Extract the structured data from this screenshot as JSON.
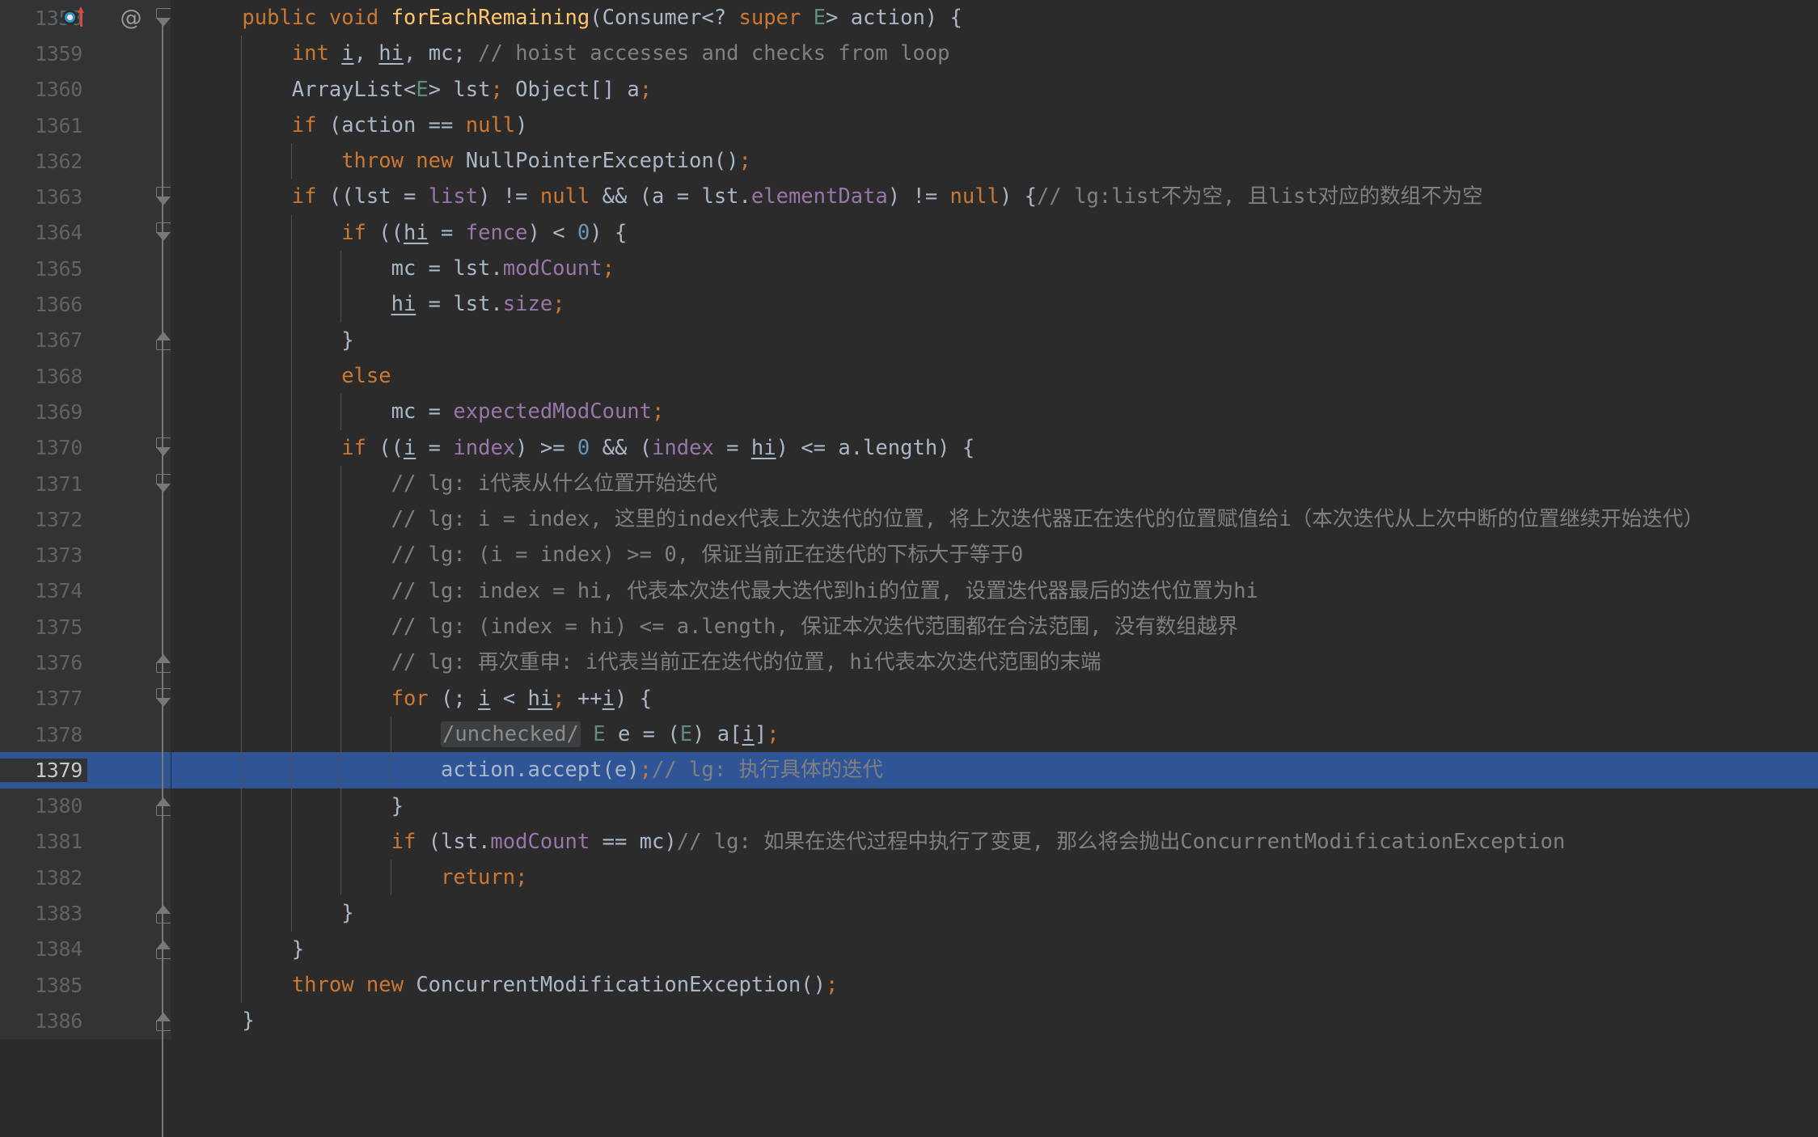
{
  "editor": {
    "theme_name": "darcula",
    "background": "#2b2b2b",
    "gutter_background": "#313335",
    "selection_color": "#2f5597",
    "caret_line": 1379,
    "colors": {
      "keyword": "#cc7832",
      "method": "#ffc66d",
      "field": "#9876aa",
      "number": "#6897bb",
      "comment": "#808080",
      "text": "#a9b7c6",
      "type_param": "#5f8c7c",
      "inlay_hint_bg": "#3c3f41",
      "line_number": "#606366"
    },
    "gutter_icons": {
      "override_icon_label": "implements-method-icon",
      "annotation_icon_label": "@",
      "fold_icon_label": "fold-region-icon",
      "bulb_icon_label": "intention-bulb-icon"
    },
    "lines": [
      {
        "number": "1358",
        "indent": 1,
        "icons": [
          "override-icon",
          "at-icon",
          "fold-collapse-icon"
        ],
        "tokens": [
          {
            "t": "kw",
            "s": "public void "
          },
          {
            "t": "meth",
            "s": "forEachRemaining"
          },
          {
            "t": "pun",
            "s": "(Consumer<? "
          },
          {
            "t": "kw",
            "s": "super "
          },
          {
            "t": "gen",
            "s": "E"
          },
          {
            "t": "pun",
            "s": "> action) {"
          }
        ]
      },
      {
        "number": "1359",
        "indent": 2,
        "icons": [],
        "tokens": [
          {
            "t": "kw",
            "s": "int "
          },
          {
            "t": "und",
            "s": "i"
          },
          {
            "t": "pun",
            "s": ", "
          },
          {
            "t": "und",
            "s": "hi"
          },
          {
            "t": "pun",
            "s": ", mc; "
          },
          {
            "t": "cmt",
            "s": "// hoist accesses and checks from loop"
          }
        ]
      },
      {
        "number": "1360",
        "indent": 2,
        "icons": [],
        "tokens": [
          {
            "t": "pun",
            "s": "ArrayList<"
          },
          {
            "t": "gen",
            "s": "E"
          },
          {
            "t": "pun",
            "s": "> lst"
          },
          {
            "t": "semi",
            "s": ";"
          },
          {
            "t": "pun",
            "s": " Object[] a"
          },
          {
            "t": "semi",
            "s": ";"
          }
        ]
      },
      {
        "number": "1361",
        "indent": 2,
        "icons": [],
        "tokens": [
          {
            "t": "kw",
            "s": "if "
          },
          {
            "t": "pun",
            "s": "(action == "
          },
          {
            "t": "kw",
            "s": "null"
          },
          {
            "t": "pun",
            "s": ")"
          }
        ]
      },
      {
        "number": "1362",
        "indent": 3,
        "icons": [],
        "tokens": [
          {
            "t": "kw",
            "s": "throw new "
          },
          {
            "t": "pun",
            "s": "NullPointerException()"
          },
          {
            "t": "semi",
            "s": ";"
          }
        ]
      },
      {
        "number": "1363",
        "indent": 2,
        "icons": [
          "fold-collapse-icon"
        ],
        "tokens": [
          {
            "t": "kw",
            "s": "if "
          },
          {
            "t": "pun",
            "s": "((lst = "
          },
          {
            "t": "fld",
            "s": "list"
          },
          {
            "t": "pun",
            "s": ") != "
          },
          {
            "t": "kw",
            "s": "null"
          },
          {
            "t": "pun",
            "s": " && (a = lst."
          },
          {
            "t": "fld",
            "s": "elementData"
          },
          {
            "t": "pun",
            "s": ") != "
          },
          {
            "t": "kw",
            "s": "null"
          },
          {
            "t": "pun",
            "s": ") {"
          },
          {
            "t": "cmt",
            "s": "// lg:list不为空, 且list对应的数组不为空"
          }
        ]
      },
      {
        "number": "1364",
        "indent": 3,
        "icons": [
          "fold-collapse-icon"
        ],
        "tokens": [
          {
            "t": "kw",
            "s": "if "
          },
          {
            "t": "pun",
            "s": "(("
          },
          {
            "t": "und",
            "s": "hi"
          },
          {
            "t": "pun",
            "s": " = "
          },
          {
            "t": "fld",
            "s": "fence"
          },
          {
            "t": "pun",
            "s": ") < "
          },
          {
            "t": "num",
            "s": "0"
          },
          {
            "t": "pun",
            "s": ") {"
          }
        ]
      },
      {
        "number": "1365",
        "indent": 4,
        "icons": [],
        "tokens": [
          {
            "t": "pun",
            "s": "mc = lst."
          },
          {
            "t": "fld",
            "s": "modCount"
          },
          {
            "t": "semi",
            "s": ";"
          }
        ]
      },
      {
        "number": "1366",
        "indent": 4,
        "icons": [],
        "tokens": [
          {
            "t": "und",
            "s": "hi"
          },
          {
            "t": "pun",
            "s": " = lst."
          },
          {
            "t": "fld",
            "s": "size"
          },
          {
            "t": "semi",
            "s": ";"
          }
        ]
      },
      {
        "number": "1367",
        "indent": 3,
        "icons": [
          "fold-expand-icon"
        ],
        "tokens": [
          {
            "t": "pun",
            "s": "}"
          }
        ]
      },
      {
        "number": "1368",
        "indent": 3,
        "icons": [],
        "tokens": [
          {
            "t": "kw",
            "s": "else"
          }
        ]
      },
      {
        "number": "1369",
        "indent": 4,
        "icons": [],
        "tokens": [
          {
            "t": "pun",
            "s": "mc = "
          },
          {
            "t": "fld",
            "s": "expectedModCount"
          },
          {
            "t": "semi",
            "s": ";"
          }
        ]
      },
      {
        "number": "1370",
        "indent": 3,
        "icons": [
          "fold-collapse-icon"
        ],
        "tokens": [
          {
            "t": "kw",
            "s": "if "
          },
          {
            "t": "pun",
            "s": "(("
          },
          {
            "t": "und",
            "s": "i"
          },
          {
            "t": "pun",
            "s": " = "
          },
          {
            "t": "fld",
            "s": "index"
          },
          {
            "t": "pun",
            "s": ") >= "
          },
          {
            "t": "num",
            "s": "0"
          },
          {
            "t": "pun",
            "s": " && ("
          },
          {
            "t": "fld",
            "s": "index"
          },
          {
            "t": "pun",
            "s": " = "
          },
          {
            "t": "und",
            "s": "hi"
          },
          {
            "t": "pun",
            "s": ") <= a.length) {"
          }
        ]
      },
      {
        "number": "1371",
        "indent": 4,
        "icons": [
          "fold-collapse-icon"
        ],
        "tokens": [
          {
            "t": "cmt",
            "s": "// lg: i代表从什么位置开始迭代"
          }
        ]
      },
      {
        "number": "1372",
        "indent": 4,
        "icons": [],
        "tokens": [
          {
            "t": "cmt",
            "s": "// lg: i = index, 这里的index代表上次迭代的位置, 将上次迭代器正在迭代的位置赋值给i（本次迭代从上次中断的位置继续开始迭代）"
          }
        ]
      },
      {
        "number": "1373",
        "indent": 4,
        "icons": [],
        "tokens": [
          {
            "t": "cmt",
            "s": "// lg: (i = index) >= 0, 保证当前正在迭代的下标大于等于0"
          }
        ]
      },
      {
        "number": "1374",
        "indent": 4,
        "icons": [],
        "tokens": [
          {
            "t": "cmt",
            "s": "// lg: index = hi, 代表本次迭代最大迭代到hi的位置, 设置迭代器最后的迭代位置为hi"
          }
        ]
      },
      {
        "number": "1375",
        "indent": 4,
        "icons": [],
        "tokens": [
          {
            "t": "cmt",
            "s": "// lg: (index = hi) <= a.length, 保证本次迭代范围都在合法范围, 没有数组越界"
          }
        ]
      },
      {
        "number": "1376",
        "indent": 4,
        "icons": [
          "fold-expand-icon"
        ],
        "tokens": [
          {
            "t": "cmt",
            "s": "// lg: 再次重申: i代表当前正在迭代的位置, hi代表本次迭代范围的末端"
          }
        ]
      },
      {
        "number": "1377",
        "indent": 4,
        "icons": [
          "fold-collapse-icon"
        ],
        "tokens": [
          {
            "t": "kw",
            "s": "for "
          },
          {
            "t": "pun",
            "s": "(; "
          },
          {
            "t": "und",
            "s": "i"
          },
          {
            "t": "pun",
            "s": " < "
          },
          {
            "t": "und",
            "s": "hi"
          },
          {
            "t": "semi",
            "s": ";"
          },
          {
            "t": "pun",
            "s": " ++"
          },
          {
            "t": "und",
            "s": "i"
          },
          {
            "t": "pun",
            "s": ") {"
          }
        ]
      },
      {
        "number": "1378",
        "indent": 5,
        "icons": [],
        "tokens": [
          {
            "t": "hint",
            "s": "/unchecked/"
          },
          {
            "t": "pun",
            "s": " "
          },
          {
            "t": "gen",
            "s": "E"
          },
          {
            "t": "pun",
            "s": " e = ("
          },
          {
            "t": "gen",
            "s": "E"
          },
          {
            "t": "pun",
            "s": ") a["
          },
          {
            "t": "und",
            "s": "i"
          },
          {
            "t": "pun",
            "s": "]"
          },
          {
            "t": "semi",
            "s": ";"
          }
        ]
      },
      {
        "number": "1379",
        "indent": 5,
        "selected": true,
        "icons": [
          "intention-bulb-icon"
        ],
        "tokens": [
          {
            "t": "pun",
            "s": "action.accept(e)"
          },
          {
            "t": "semi",
            "s": ";"
          },
          {
            "t": "cmt",
            "s": "// lg: 执行具体的迭代"
          }
        ]
      },
      {
        "number": "1380",
        "indent": 4,
        "icons": [
          "fold-expand-icon"
        ],
        "tokens": [
          {
            "t": "pun",
            "s": "}"
          }
        ]
      },
      {
        "number": "1381",
        "indent": 4,
        "icons": [],
        "tokens": [
          {
            "t": "kw",
            "s": "if "
          },
          {
            "t": "pun",
            "s": "(lst."
          },
          {
            "t": "fld",
            "s": "modCount"
          },
          {
            "t": "pun",
            "s": " == mc)"
          },
          {
            "t": "cmt",
            "s": "// lg: 如果在迭代过程中执行了变更, 那么将会抛出ConcurrentModificationException"
          }
        ]
      },
      {
        "number": "1382",
        "indent": 5,
        "icons": [],
        "tokens": [
          {
            "t": "kw",
            "s": "return"
          },
          {
            "t": "semi",
            "s": ";"
          }
        ]
      },
      {
        "number": "1383",
        "indent": 3,
        "icons": [
          "fold-expand-icon"
        ],
        "tokens": [
          {
            "t": "pun",
            "s": "}"
          }
        ]
      },
      {
        "number": "1384",
        "indent": 2,
        "icons": [
          "fold-expand-icon"
        ],
        "tokens": [
          {
            "t": "pun",
            "s": "}"
          }
        ]
      },
      {
        "number": "1385",
        "indent": 2,
        "icons": [],
        "tokens": [
          {
            "t": "kw",
            "s": "throw new "
          },
          {
            "t": "pun",
            "s": "ConcurrentModificationException()"
          },
          {
            "t": "semi",
            "s": ";"
          }
        ]
      },
      {
        "number": "1386",
        "indent": 1,
        "icons": [
          "fold-expand-icon"
        ],
        "tokens": [
          {
            "t": "pun",
            "s": "}"
          }
        ]
      }
    ]
  }
}
